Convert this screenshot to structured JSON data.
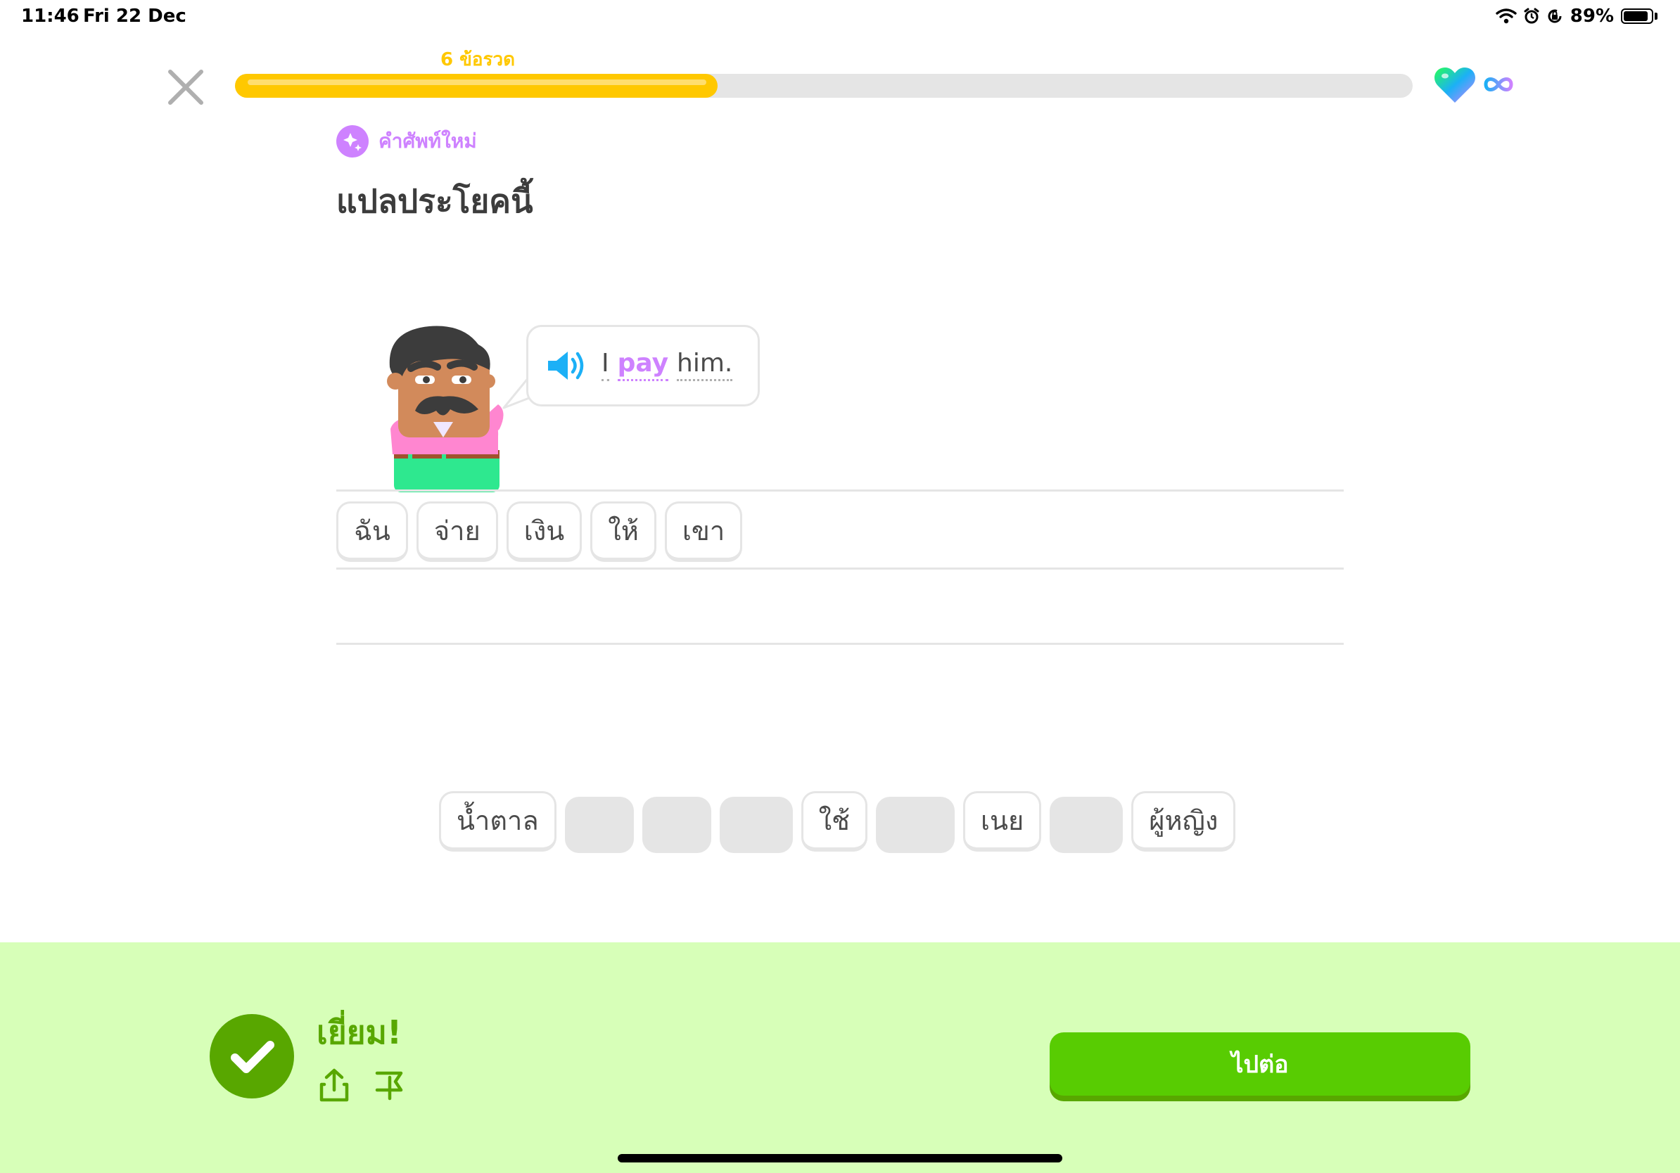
{
  "status_bar": {
    "time": "11:46",
    "date": "Fri 22 Dec",
    "battery_text": "89%",
    "battery_level": 0.89,
    "icons": [
      "wifi-icon",
      "alarm-icon",
      "rotation-lock-icon",
      "battery-icon"
    ]
  },
  "header": {
    "streak_label": "6 ข้อรวด",
    "progress": 0.41,
    "hearts": "∞",
    "close_icon": "close-icon",
    "heart_icon": "heart-icon"
  },
  "prompt": {
    "badge_label": "คำศัพท์ใหม่",
    "title": "แปลประโยคนี้"
  },
  "bubble": {
    "speaker_icon": "speaker-icon",
    "words": [
      {
        "text": "I",
        "highlight": false
      },
      {
        "text": "pay",
        "highlight": true
      },
      {
        "text": "him.",
        "highlight": false
      }
    ]
  },
  "answer": [
    "ฉัน",
    "จ่าย",
    "เงิน",
    "ให้",
    "เขา"
  ],
  "word_bank": [
    {
      "text": "น้ำตาล",
      "used": false
    },
    {
      "text": "",
      "used": true
    },
    {
      "text": "",
      "used": true
    },
    {
      "text": "",
      "used": true
    },
    {
      "text": "ใช้",
      "used": false
    },
    {
      "text": "",
      "used": true
    },
    {
      "text": "เนย",
      "used": false
    },
    {
      "text": "",
      "used": true
    },
    {
      "text": "ผู้หญิง",
      "used": false
    }
  ],
  "feedback": {
    "title": "เยี่ยม!",
    "continue_label": "ไปต่อ"
  },
  "colors": {
    "progress": "#ffc800",
    "accent_purple": "#ce82ff",
    "success_bg": "#d7ffb8",
    "success_dark": "#58a700",
    "button_green": "#58cc02",
    "speaker_blue": "#1cb0f6"
  }
}
